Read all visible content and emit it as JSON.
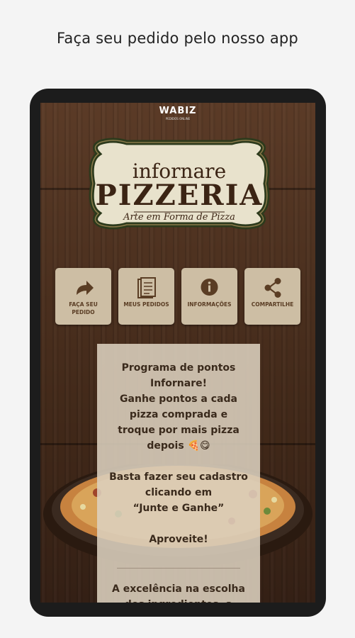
{
  "caption": "Faça seu pedido pelo nosso app",
  "brand": {
    "name": "WABIZ",
    "tagline": "PEDIDOS ONLINE"
  },
  "sign": {
    "line1": "infornare",
    "line2": "PIZZERIA",
    "line3": "Arte em Forma de Pizza"
  },
  "tiles": [
    {
      "label": "FAÇA SEU PEDIDO",
      "icon": "share-arrow-icon"
    },
    {
      "label": "MEUS PEDIDOS",
      "icon": "document-list-icon"
    },
    {
      "label": "INFORMAÇÕES",
      "icon": "info-icon"
    },
    {
      "label": "COMPARTILHE",
      "icon": "share-icon"
    }
  ],
  "message": {
    "lines": [
      "Programa de pontos",
      "Infornare!",
      "Ganhe pontos a cada",
      "pizza comprada e",
      "troque por mais pizza",
      "depois 🍕😋",
      "",
      "Basta fazer seu cadastro",
      "clicando em",
      "“Junte e Ganhe”",
      "",
      "Aproveite!"
    ],
    "footer": "A excelência na escolha",
    "footer_cut": "dos ingredientes, a"
  },
  "colors": {
    "tile_bg": "#cdbea4",
    "tile_text": "#5a3d24",
    "card_bg": "#dcd0be",
    "wood": "#4a2f1e"
  }
}
